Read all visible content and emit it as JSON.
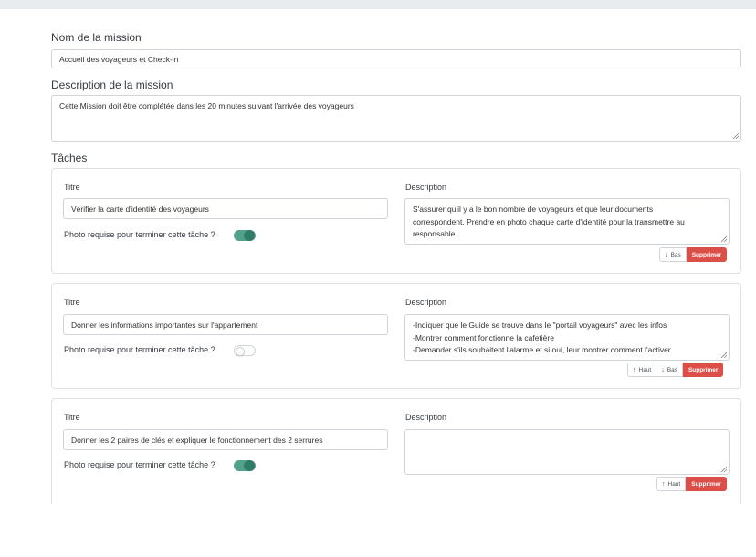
{
  "mission": {
    "name_label": "Nom de la mission",
    "name_value": "Accueil des voyageurs et Check-in",
    "description_label": "Description de la mission",
    "description_value": "Cette Mission doit être complétée dans les 20 minutes suivant l'arrivée des voyageurs"
  },
  "tasks_heading": "Tâches",
  "task_labels": {
    "title": "Titre",
    "description": "Description",
    "photo_required": "Photo requise pour terminer cette tâche ?"
  },
  "buttons": {
    "up": "Haut",
    "down": "Bas",
    "delete": "Supprimer"
  },
  "icons": {
    "up": "arrow-up-icon",
    "down": "arrow-down-icon"
  },
  "colors": {
    "toggle_on": "#52a18a",
    "danger": "#dc4e48"
  },
  "tasks": [
    {
      "title": "Vérifier la carte d'identité des voyageurs",
      "description_lines": [
        "S'assurer qu'il y a le bon nombre de voyageurs et que leur documents",
        "correspondent. Prendre en photo chaque carte d'identité pour la transmettre au",
        "responsable."
      ],
      "photo_required": true
    },
    {
      "title": "Donner les informations importantes sur l'appartement",
      "description_lines": [
        "-Indiquer que le Guide se trouve dans le \"portail voyageurs\" avec les infos",
        "-Montrer comment fonctionne la cafetière",
        "-Demander s'ils souhaitent l'alarme et si oui, leur montrer comment l'activer"
      ],
      "photo_required": false
    },
    {
      "title": "Donner les 2 paires de clés et expliquer le fonctionnement des 2 serrures",
      "description_lines": [],
      "photo_required": true
    }
  ]
}
